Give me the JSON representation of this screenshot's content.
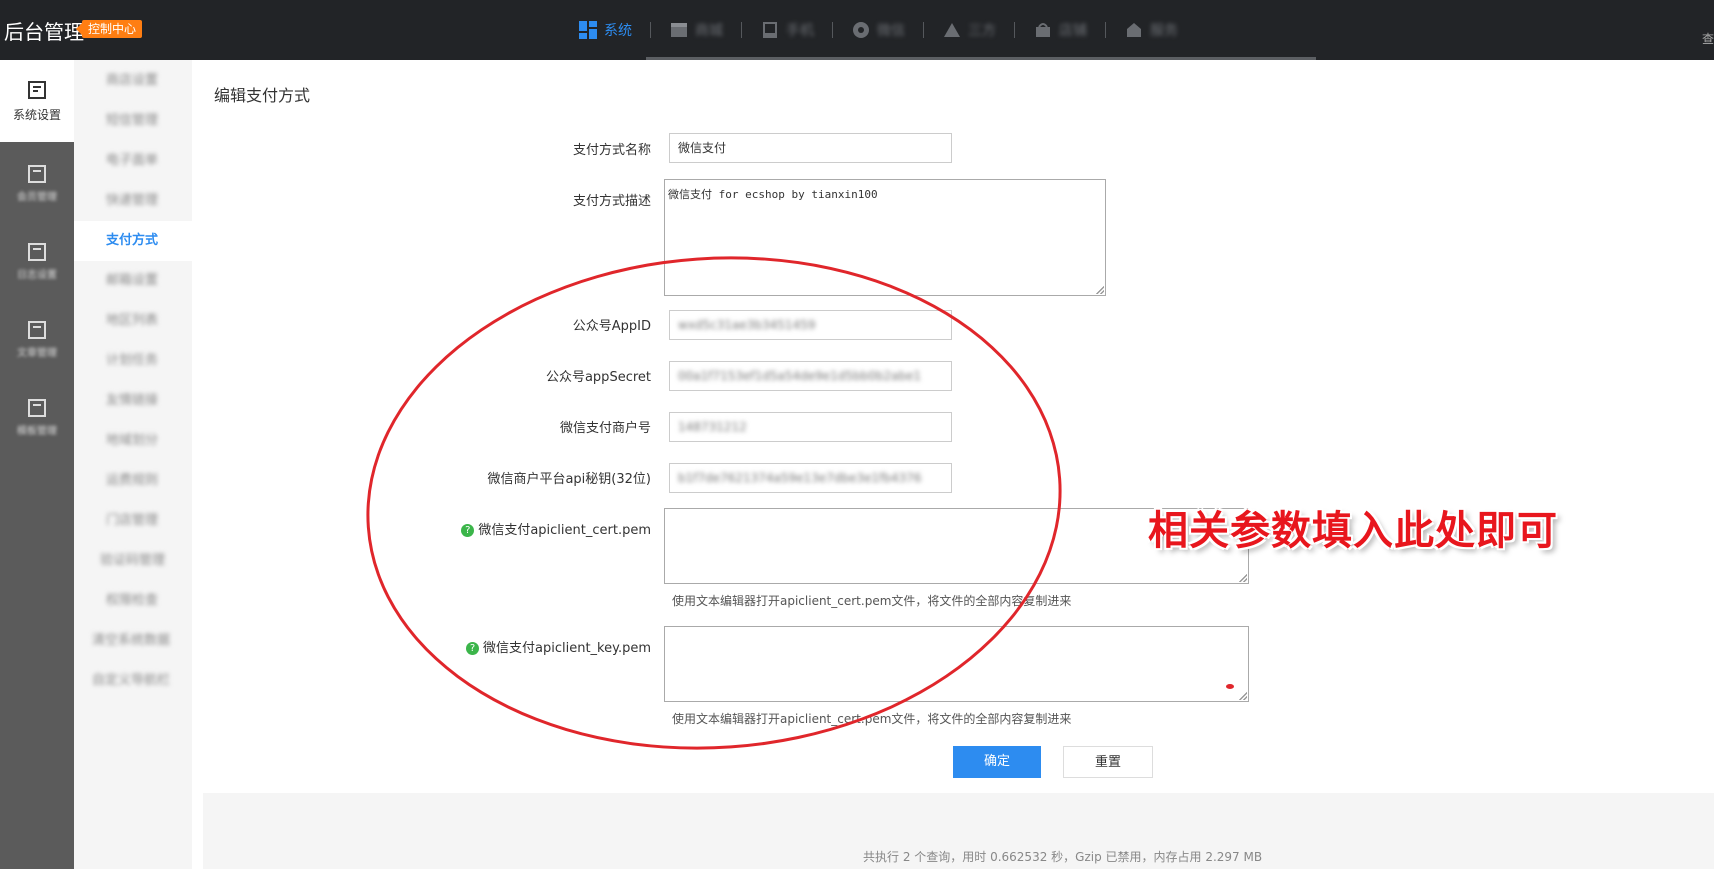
{
  "topbar": {
    "brand": "后台管理",
    "badge": "控制中心",
    "nav": [
      {
        "label": "系统",
        "icon": "grid-icon",
        "active": true
      },
      {
        "label": "商城",
        "icon": "store-icon",
        "active": false
      },
      {
        "label": "手机",
        "icon": "mobile-icon",
        "active": false
      },
      {
        "label": "微信",
        "icon": "wechat-icon",
        "active": false
      },
      {
        "label": "三方",
        "icon": "triangle-icon",
        "active": false
      },
      {
        "label": "店铺",
        "icon": "shop-icon",
        "active": false
      },
      {
        "label": "服务",
        "icon": "service-icon",
        "active": false
      }
    ],
    "right_text": "查"
  },
  "leftbar": {
    "items": [
      {
        "label": "系统设置",
        "icon": "settings-doc-icon"
      },
      {
        "label": "会员管理",
        "icon": "doc-icon"
      },
      {
        "label": "日志设置",
        "icon": "doc-icon"
      },
      {
        "label": "文章管理",
        "icon": "doc-icon"
      },
      {
        "label": "模板管理",
        "icon": "doc-icon"
      }
    ]
  },
  "submenu": {
    "items": [
      {
        "label": "商店设置",
        "active": false
      },
      {
        "label": "短信管理",
        "active": false
      },
      {
        "label": "电子面单",
        "active": false
      },
      {
        "label": "快递管理",
        "active": false
      },
      {
        "label": "支付方式",
        "active": true
      },
      {
        "label": "邮箱设置",
        "active": false
      },
      {
        "label": "地区列表",
        "active": false
      },
      {
        "label": "计划任务",
        "active": false
      },
      {
        "label": "友情链接",
        "active": false
      },
      {
        "label": "地域划分",
        "active": false
      },
      {
        "label": "运费规则",
        "active": false
      },
      {
        "label": "门店管理",
        "active": false
      },
      {
        "label": "验证码管理",
        "active": false
      },
      {
        "label": "权限检查",
        "active": false
      },
      {
        "label": "清空系统数据",
        "active": false
      },
      {
        "label": "自定义导航栏",
        "active": false
      }
    ]
  },
  "form": {
    "title": "编辑支付方式",
    "name_label": "支付方式名称",
    "name_value": "微信支付",
    "desc_label": "支付方式描述",
    "desc_value": "微信支付 for ecshop by tianxin100",
    "appid_label": "公众号AppID",
    "appid_value": "wxd5c31ae3b3451459",
    "secret_label": "公众号appSecret",
    "secret_value": "00a1f7153ef1d5a54de9e1d5bb0b2abe1",
    "mchid_label": "微信支付商户号",
    "mchid_value": "148731212",
    "apikey_label": "微信商户平台api秘钥(32位)",
    "apikey_value": "b1f7de7621374a59e13e7dbe3e1fb4376",
    "cert_label": "微信支付apiclient_cert.pem",
    "cert_hint": "使用文本编辑器打开apiclient_cert.pem文件，将文件的全部内容复制进来",
    "key_label": "微信支付apiclient_key.pem",
    "key_hint": "使用文本编辑器打开apiclient_cert.pem文件，将文件的全部内容复制进来",
    "confirm": "确定",
    "reset": "重置"
  },
  "annotation": "相关参数填入此处即可",
  "footer": "共执行 2 个查询，用时 0.662532 秒，Gzip 已禁用，内存占用 2.297 MB",
  "colors": {
    "accent": "#2d8cf0",
    "badge": "#ff7e12",
    "annotation": "#e8161d"
  }
}
